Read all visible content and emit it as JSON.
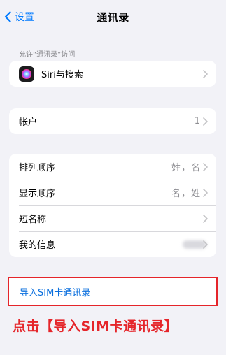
{
  "nav": {
    "back_label": "设置",
    "title": "通讯录"
  },
  "siri_section": {
    "header": "允许“通讯录”访问",
    "siri_label": "Siri与搜索"
  },
  "accounts": {
    "label": "帐户",
    "value": "1"
  },
  "settings_rows": [
    {
      "label": "排列顺序",
      "value": "姓，名"
    },
    {
      "label": "显示顺序",
      "value": "名，姓"
    },
    {
      "label": "短名称",
      "value": ""
    },
    {
      "label": "我的信息",
      "value": ""
    }
  ],
  "import": {
    "label": "导入SIM卡通讯录"
  },
  "annotation": {
    "caption": "点击【导入SIM卡通讯录】"
  },
  "colors": {
    "accent": "#007aff",
    "highlight": "#e5252a",
    "background": "#f2f2f7"
  },
  "icons": [
    "chevron-left-icon",
    "siri-icon",
    "chevron-right-icon"
  ]
}
